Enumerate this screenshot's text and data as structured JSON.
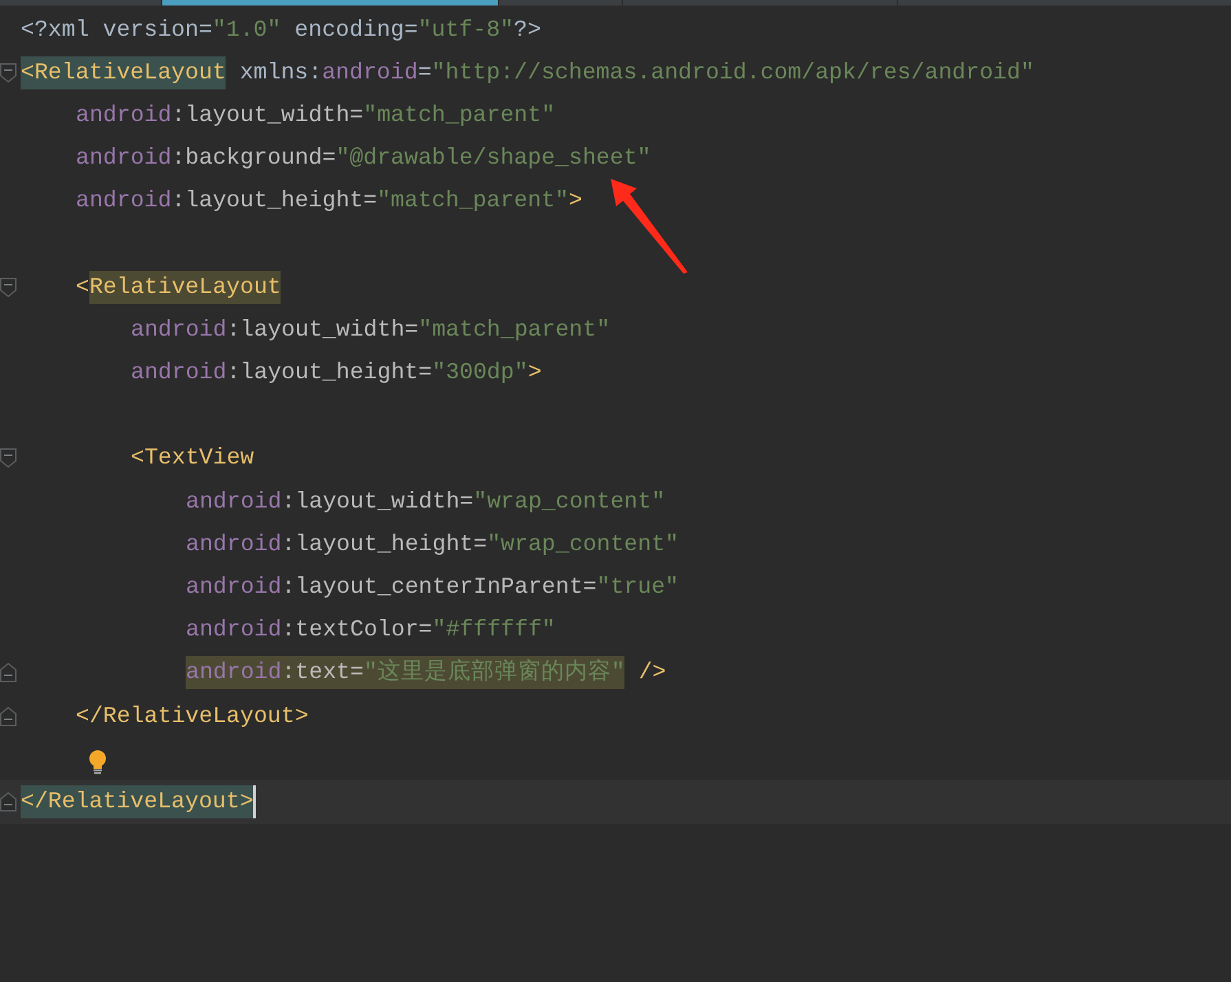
{
  "tab_strip": [
    {
      "selected": false
    },
    {
      "selected": true
    },
    {
      "selected": false
    },
    {
      "selected": false
    }
  ],
  "lines": [
    {
      "kind": "line",
      "current": false,
      "segments": [
        {
          "kind": "plain",
          "text": "<?xml version="
        },
        {
          "kind": "string",
          "text": "\"1.0\""
        },
        {
          "kind": "plain",
          "text": " encoding="
        },
        {
          "kind": "string",
          "text": "\"utf-8\""
        },
        {
          "kind": "plain",
          "text": "?>"
        }
      ]
    },
    {
      "kind": "fold-start",
      "current": false,
      "segments": [
        {
          "kind": "tag",
          "text": "<RelativeLayout",
          "color": "#3b514d"
        },
        {
          "kind": "plain",
          "text": " xmlns:"
        },
        {
          "kind": "ns",
          "text": "android"
        },
        {
          "kind": "plain",
          "text": "="
        },
        {
          "kind": "string",
          "text": "\"http://schemas.android.com/apk/res/android\""
        }
      ],
      "children": [
        {
          "kind": "line",
          "current": false,
          "segments": [
            {
              "kind": "ns",
              "text": "android"
            },
            {
              "kind": "attr",
              "text": ":layout_width="
            },
            {
              "kind": "string",
              "text": "\"match_parent\""
            }
          ]
        },
        {
          "kind": "line",
          "current": false,
          "segments": [
            {
              "kind": "ns",
              "text": "android"
            },
            {
              "kind": "attr",
              "text": ":background="
            },
            {
              "kind": "string",
              "text": "\"@drawable/shape_sheet\""
            }
          ]
        },
        {
          "kind": "line",
          "current": false,
          "segments": [
            {
              "kind": "ns",
              "text": "android"
            },
            {
              "kind": "attr",
              "text": ":layout_height="
            },
            {
              "kind": "string",
              "text": "\"match_parent\""
            },
            {
              "kind": "tag",
              "text": ">"
            }
          ]
        },
        {
          "kind": "line",
          "current": false
        },
        {
          "kind": "fold-start",
          "current": false,
          "segments": [
            {
              "kind": "tag",
              "text": "<"
            },
            {
              "kind": "tag",
              "text": "RelativeLayout",
              "color": "#4d4a34"
            }
          ],
          "children": [
            {
              "kind": "line",
              "current": false,
              "segments": [
                {
                  "kind": "ns",
                  "text": "android"
                },
                {
                  "kind": "attr",
                  "text": ":layout_width="
                },
                {
                  "kind": "string",
                  "text": "\"match_parent\""
                }
              ]
            },
            {
              "kind": "line",
              "current": false,
              "segments": [
                {
                  "kind": "ns",
                  "text": "android"
                },
                {
                  "kind": "attr",
                  "text": ":layout_height="
                },
                {
                  "kind": "string",
                  "text": "\"300dp\""
                },
                {
                  "kind": "tag",
                  "text": ">"
                }
              ]
            },
            {
              "kind": "line",
              "current": false
            },
            {
              "kind": "fold-start",
              "current": false,
              "segments": [
                {
                  "kind": "tag",
                  "text": "<TextView"
                }
              ],
              "children": [
                {
                  "kind": "line",
                  "current": false,
                  "segments": [
                    {
                      "kind": "ns",
                      "text": "android"
                    },
                    {
                      "kind": "attr",
                      "text": ":layout_width="
                    },
                    {
                      "kind": "string",
                      "text": "\"wrap_content\""
                    }
                  ]
                },
                {
                  "kind": "line",
                  "current": false,
                  "segments": [
                    {
                      "kind": "ns",
                      "text": "android"
                    },
                    {
                      "kind": "attr",
                      "text": ":layout_height="
                    },
                    {
                      "kind": "string",
                      "text": "\"wrap_content\""
                    }
                  ]
                },
                {
                  "kind": "line",
                  "current": false,
                  "segments": [
                    {
                      "kind": "ns",
                      "text": "android"
                    },
                    {
                      "kind": "attr",
                      "text": ":layout_centerInParent="
                    },
                    {
                      "kind": "string",
                      "text": "\"true\""
                    }
                  ]
                },
                {
                  "kind": "line",
                  "current": false,
                  "segments": [
                    {
                      "kind": "ns",
                      "text": "android"
                    },
                    {
                      "kind": "attr",
                      "text": ":textColor="
                    },
                    {
                      "kind": "string",
                      "text": "\"#ffffff\""
                    }
                  ]
                },
                {
                  "kind": "fold-end",
                  "current": false,
                  "segments": [
                    {
                      "kind": "ns",
                      "text": "android",
                      "color": "#4d4a34"
                    },
                    {
                      "kind": "attr",
                      "text": ":text=",
                      "color": "#4d4a34"
                    },
                    {
                      "kind": "string",
                      "text": "\"这里是底部弹窗的内容\"",
                      "color": "#4d4a34"
                    },
                    {
                      "kind": "tag",
                      "text": " />"
                    }
                  ]
                }
              ]
            }
          ]
        },
        {
          "kind": "fold-end",
          "current": false,
          "segments": [
            {
              "kind": "tag",
              "text": "</RelativeLayout>"
            }
          ]
        },
        {
          "kind": "line",
          "current": false,
          "lightbulb": true
        }
      ]
    },
    {
      "kind": "fold-end",
      "current": true,
      "segments": [
        {
          "kind": "tag",
          "text": "</RelativeLayout>",
          "color": "#3b514d"
        }
      ]
    }
  ]
}
